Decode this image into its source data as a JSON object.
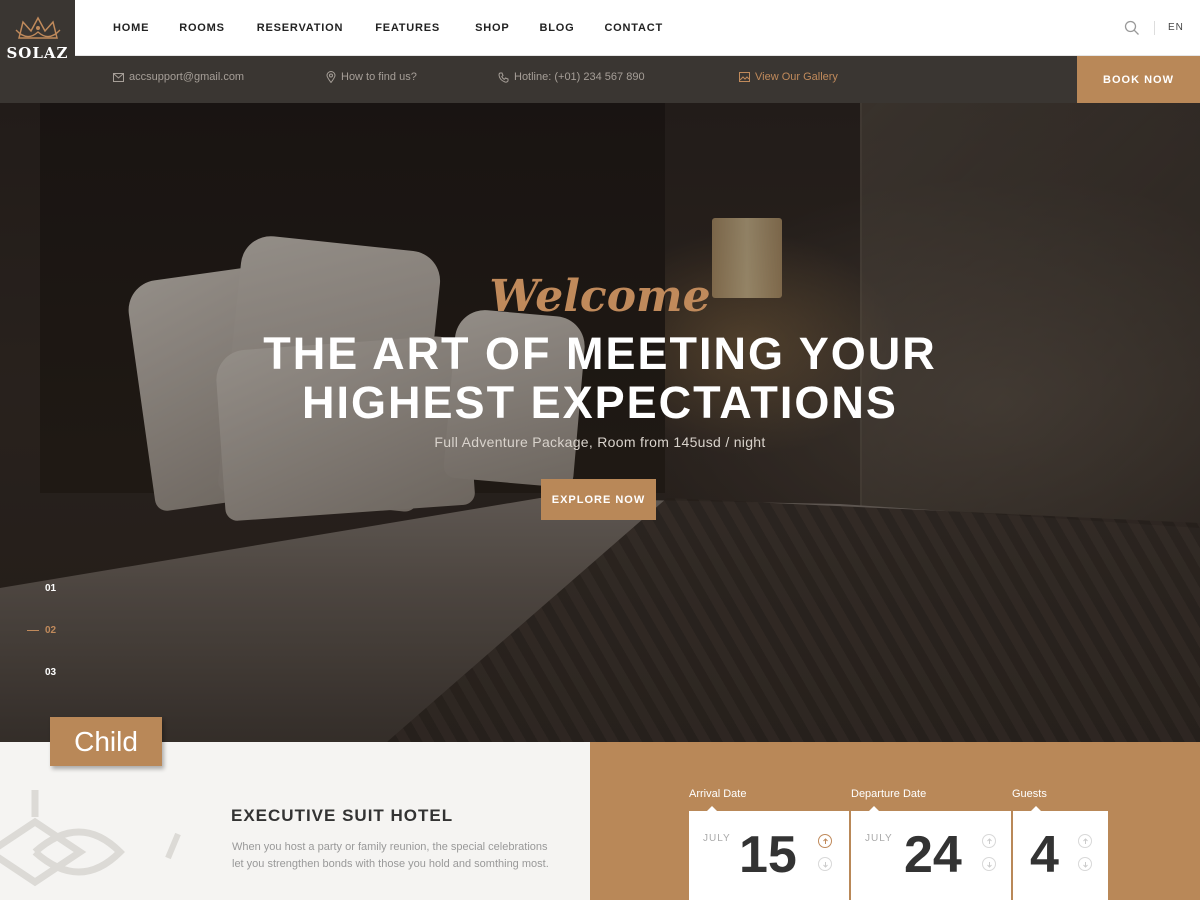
{
  "brand": {
    "name": "SOLAZ"
  },
  "nav": {
    "items": [
      "HOME",
      "ROOMS",
      "RESERVATION",
      "FEATURES",
      "SHOP",
      "BLOG",
      "CONTACT"
    ],
    "language": "EN"
  },
  "infobar": {
    "email": "accsupport@gmail.com",
    "location": "How to find us?",
    "hotline": "Hotline: (+01) 234 567 890",
    "gallery": "View Our Gallery",
    "book_label": "BOOK NOW"
  },
  "hero": {
    "script_title": "Welcome",
    "title_line1": "THE ART OF MEETING YOUR",
    "title_line2": "HIGHEST EXPECTATIONS",
    "subtitle": "Full Adventure Package, Room from 145usd / night",
    "button_label": "EXPLORE NOW",
    "slides": [
      "01",
      "02",
      "03"
    ],
    "active_slide": "02"
  },
  "badge": {
    "label": "Child"
  },
  "about": {
    "title": "EXECUTIVE SUIT HOTEL",
    "text": "When you host a party or family reunion, the special celebrations let you strengthen bonds with those you hold and somthing most."
  },
  "booking": {
    "arrival": {
      "label": "Arrival Date",
      "month": "JULY",
      "day": "15"
    },
    "departure": {
      "label": "Departure Date",
      "month": "JULY",
      "day": "24"
    },
    "guests": {
      "label": "Guests",
      "count": "4"
    }
  },
  "colors": {
    "accent": "#b98858",
    "dark": "#3a3632",
    "light_bg": "#f5f4f2"
  },
  "icons": [
    "crown-logo-icon",
    "search-icon",
    "mail-icon",
    "map-pin-icon",
    "phone-icon",
    "image-icon",
    "arrow-up-icon",
    "arrow-down-icon"
  ]
}
